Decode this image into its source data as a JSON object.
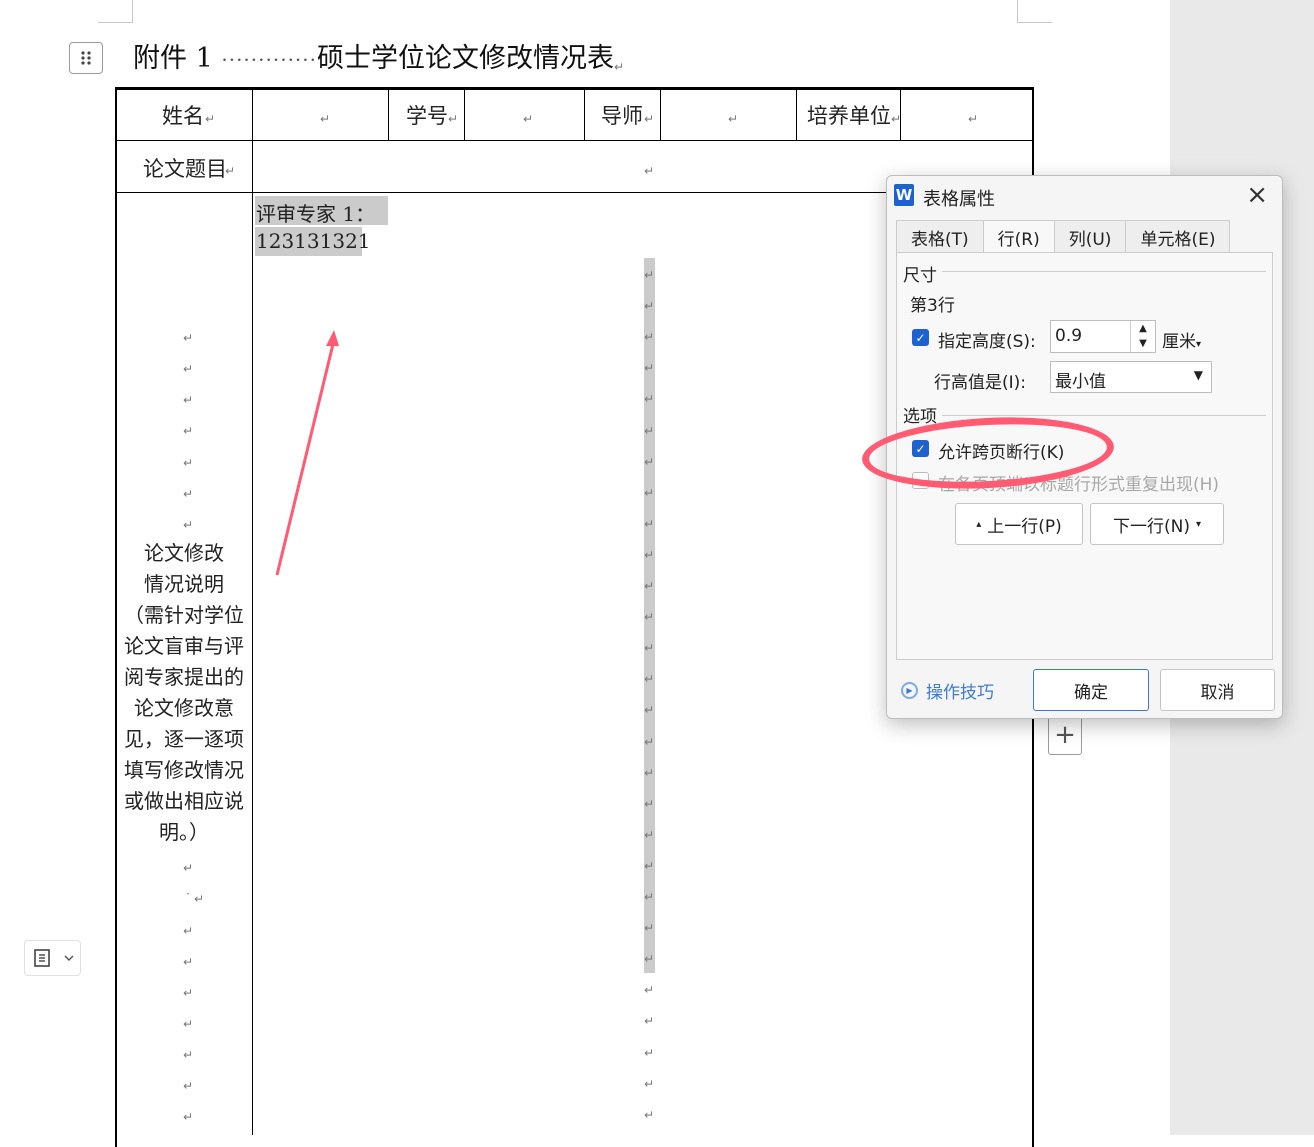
{
  "document": {
    "title_prefix": "附件 1",
    "title_dots": "·············",
    "title_main": "硕士学位论文修改情况表",
    "para_mark": "↵",
    "headers": {
      "name": "姓名",
      "student_id": "学号",
      "advisor": "导师",
      "unit": "培养单位",
      "thesis_title": "论文题目"
    },
    "reviewer_label": "评审专家 1：",
    "reviewer_value": "123131321",
    "notes": "论文修改情况说明（需针对学位论文盲审与评阅专家提出的论文修改意见，逐一逐项填写修改情况或做出相应说明。）",
    "notes_lines": [
      "论文修改",
      "情况说明",
      "（需针对学位",
      "论文盲审与评",
      "阅专家提出的",
      "论文修改意",
      "见，逐一逐项",
      "填写修改情况",
      "或做出相应说",
      "明。）"
    ],
    "stray_bullet": "·"
  },
  "dialog": {
    "app_icon": "W",
    "title": "表格属性",
    "tabs": [
      "表格(T)",
      "行(R)",
      "列(U)",
      "单元格(E)"
    ],
    "active_tab": "行(R)",
    "size_group": "尺寸",
    "row_label": "第3行",
    "specify_height_label": "指定高度(S):",
    "height_value": "0.9",
    "unit": "厘米",
    "row_height_is_label": "行高值是(I):",
    "row_height_mode": "最小值",
    "options_group": "选项",
    "allow_break_label": "允许跨页断行(K)",
    "repeat_header_label": "在各页顶端以标题行形式重复出现(H)",
    "prev_row": "上一行(P)",
    "next_row": "下一行(N)",
    "tips": "操作技巧",
    "ok": "确定",
    "cancel": "取消",
    "accent": "#1e62d0",
    "highlight_color": "#ff5b73"
  }
}
